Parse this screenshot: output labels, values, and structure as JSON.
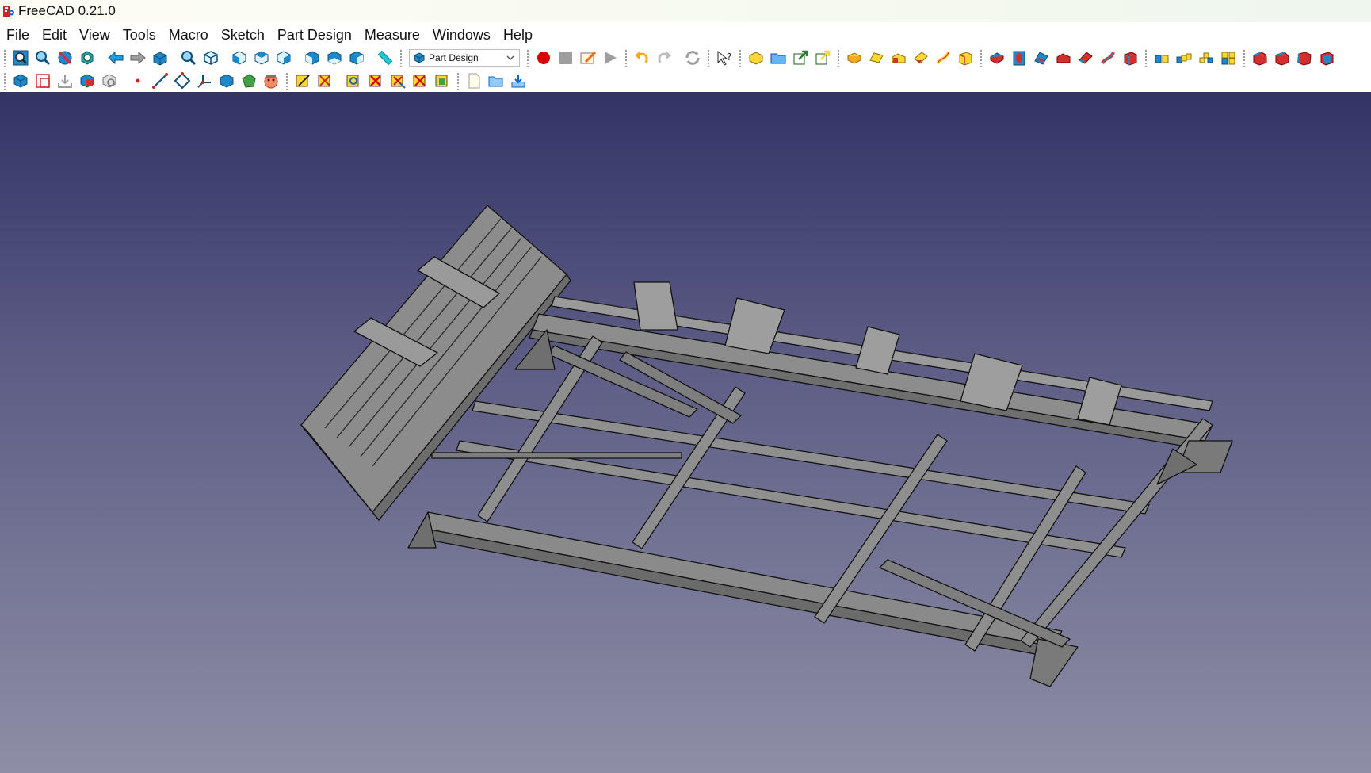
{
  "window": {
    "title": "FreeCAD 0.21.0"
  },
  "menubar": {
    "items": [
      "File",
      "Edit",
      "View",
      "Tools",
      "Macro",
      "Sketch",
      "Part Design",
      "Measure",
      "Windows",
      "Help"
    ]
  },
  "workbench": {
    "selected": "Part Design"
  },
  "colors": {
    "viewport_top": "#333366",
    "viewport_bottom": "#8e8ea6",
    "model_face": "#8a8a8a",
    "model_edge": "#111111"
  }
}
